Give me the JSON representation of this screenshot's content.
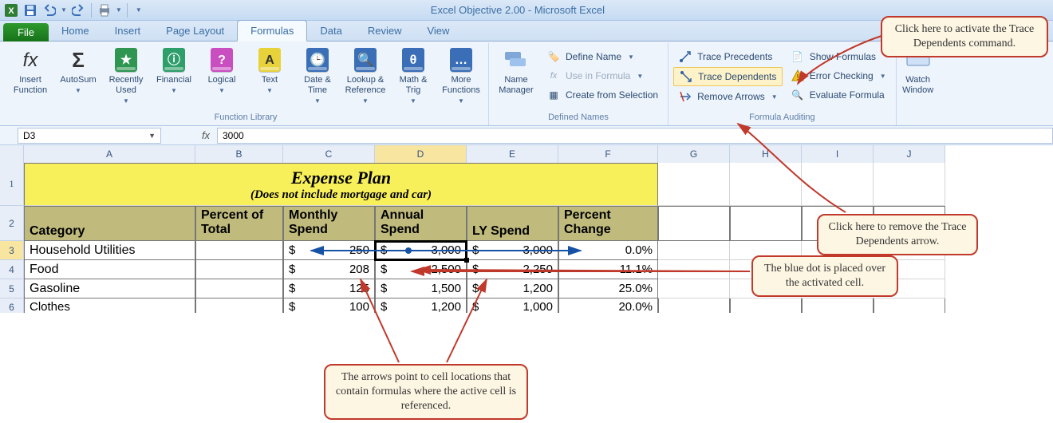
{
  "title": "Excel Objective 2.00  -  Microsoft Excel",
  "tabs": {
    "file": "File",
    "list": [
      "Home",
      "Insert",
      "Page Layout",
      "Formulas",
      "Data",
      "Review",
      "View"
    ],
    "active": "Formulas"
  },
  "ribbon": {
    "groups": {
      "func_lib": "Function Library",
      "defined": "Defined Names",
      "audit": "Formula Auditing"
    },
    "buttons": {
      "insert_function": "Insert Function",
      "autosum": "AutoSum",
      "recent": "Recently Used",
      "financial": "Financial",
      "logical": "Logical",
      "text": "Text",
      "date_time": "Date & Time",
      "lookup": "Lookup & Reference",
      "math": "Math & Trig",
      "more": "More Functions",
      "name_mgr": "Name Manager",
      "define_name": "Define Name",
      "use_in_formula": "Use in Formula",
      "create_sel": "Create from Selection",
      "trace_prec": "Trace Precedents",
      "trace_dep": "Trace Dependents",
      "remove_arrows": "Remove Arrows",
      "show_formulas": "Show Formulas",
      "error_check": "Error Checking",
      "eval_formula": "Evaluate Formula",
      "watch": "Watch Window"
    }
  },
  "namebox": "D3",
  "formula": "3000",
  "columns": [
    "A",
    "B",
    "C",
    "D",
    "E",
    "F",
    "G",
    "H",
    "I",
    "J"
  ],
  "rows": [
    "1",
    "2",
    "3",
    "4",
    "5",
    "6"
  ],
  "sheet": {
    "title_main": "Expense Plan",
    "title_sub": "(Does not include mortgage and car)",
    "headers": {
      "category": "Category",
      "percent_total_l1": "Percent of",
      "percent_total_l2": "Total",
      "monthly_l1": "Monthly",
      "monthly_l2": "Spend",
      "annual_l1": "Annual",
      "annual_l2": "Spend",
      "ly": "LY Spend",
      "pct_l1": "Percent",
      "pct_l2": "Change"
    },
    "data": [
      {
        "cat": "Household Utilities",
        "monthly": "250",
        "annual": "3,000",
        "ly": "3,000",
        "pct": "0.0%"
      },
      {
        "cat": "Food",
        "monthly": "208",
        "annual": "2,500",
        "ly": "2,250",
        "pct": "11.1%"
      },
      {
        "cat": "Gasoline",
        "monthly": "125",
        "annual": "1,500",
        "ly": "1,200",
        "pct": "25.0%"
      },
      {
        "cat": "Clothes",
        "monthly": "100",
        "annual": "1,200",
        "ly": "1,000",
        "pct": "20.0%"
      }
    ],
    "currency": "$"
  },
  "callouts": {
    "c1": "Click here to activate the Trace Dependents command.",
    "c2": "Click here to remove the Trace Dependents arrow.",
    "c3": "The blue dot is placed over the activated cell.",
    "c4": "The arrows point to cell locations that contain formulas where the active cell is referenced."
  }
}
